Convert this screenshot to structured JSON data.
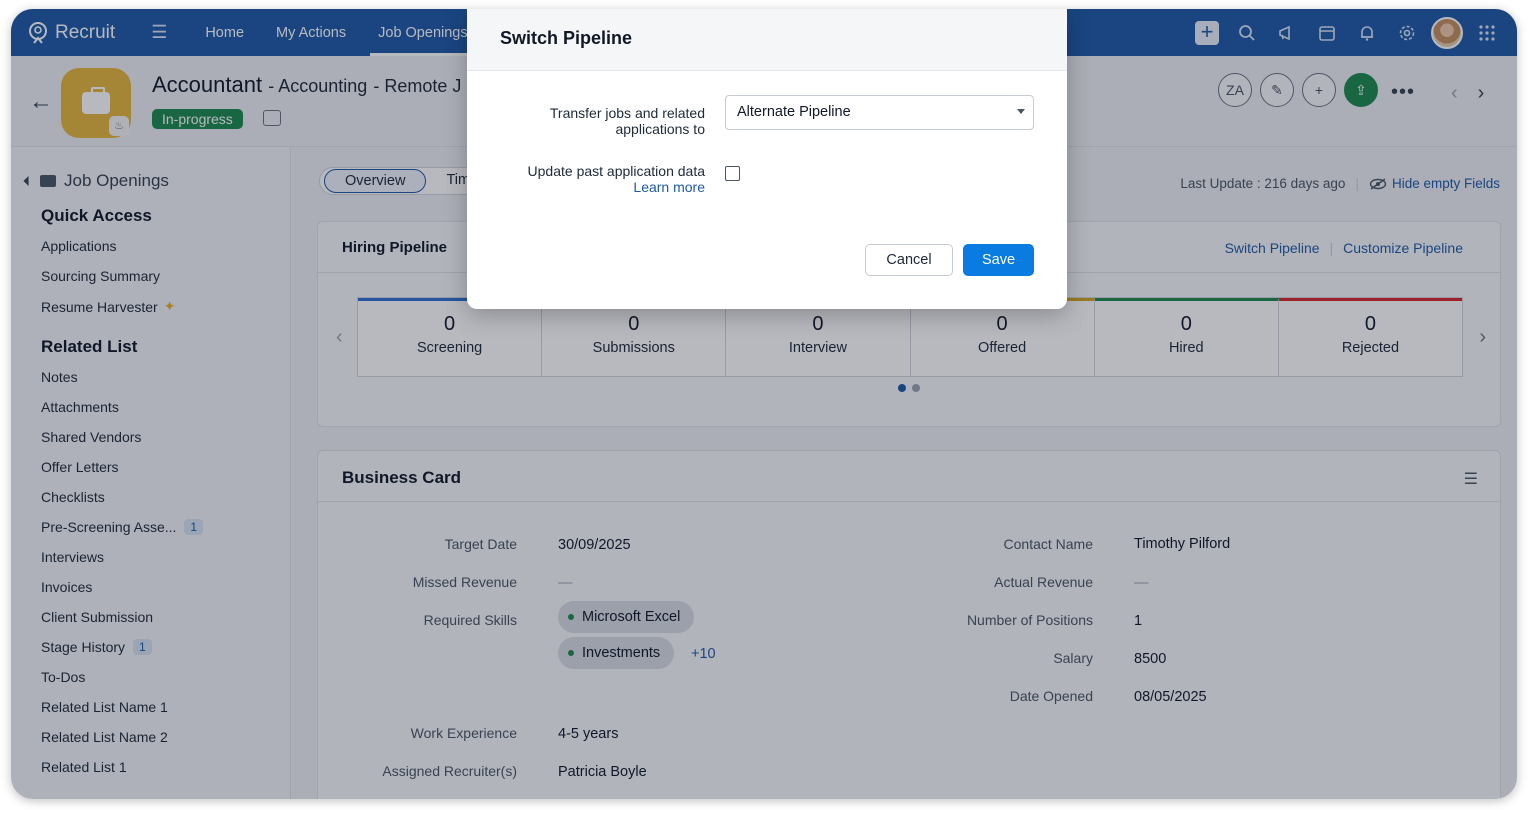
{
  "app": {
    "name": "Recruit"
  },
  "nav": {
    "links": [
      "Home",
      "My Actions",
      "Job Openings"
    ],
    "active_index": 2
  },
  "header": {
    "title": "Accountant",
    "department": "Accounting",
    "location_partial": "Remote J",
    "status": "In-progress"
  },
  "sidebar": {
    "module": "Job Openings",
    "quick_access_title": "Quick Access",
    "quick_access": [
      {
        "label": "Applications"
      },
      {
        "label": "Sourcing Summary"
      },
      {
        "label": "Resume Harvester"
      }
    ],
    "related_list_title": "Related List",
    "related_list": [
      {
        "label": "Notes",
        "count": ""
      },
      {
        "label": "Attachments",
        "count": ""
      },
      {
        "label": "Shared Vendors",
        "count": ""
      },
      {
        "label": "Offer Letters",
        "count": ""
      },
      {
        "label": "Checklists",
        "count": ""
      },
      {
        "label": "Pre-Screening Asse...",
        "count": "1"
      },
      {
        "label": "Interviews",
        "count": ""
      },
      {
        "label": "Invoices",
        "count": ""
      },
      {
        "label": "Client Submission",
        "count": ""
      },
      {
        "label": "Stage History",
        "count": "1"
      },
      {
        "label": "To-Dos",
        "count": ""
      },
      {
        "label": "Related List Name 1",
        "count": ""
      },
      {
        "label": "Related List Name 2",
        "count": ""
      },
      {
        "label": "Related List 1",
        "count": ""
      }
    ]
  },
  "main": {
    "tabs": [
      "Overview",
      "Tim"
    ],
    "last_update": "Last Update : 216 days ago",
    "hide_empty": "Hide empty Fields"
  },
  "pipeline": {
    "title": "Hiring Pipeline",
    "switch_link": "Switch Pipeline",
    "customize_link": "Customize Pipeline",
    "stages": [
      {
        "label": "Screening",
        "count": "0",
        "color": "#2f6fd6"
      },
      {
        "label": "Submissions",
        "count": "0",
        "color": "#2f6fd6"
      },
      {
        "label": "Interview",
        "count": "0",
        "color": "#e0a21a"
      },
      {
        "label": "Offered",
        "count": "0",
        "color": "#d6a51e"
      },
      {
        "label": "Hired",
        "count": "0",
        "color": "#1e8a4c"
      },
      {
        "label": "Rejected",
        "count": "0",
        "color": "#d62828"
      }
    ],
    "page": 1,
    "pages": 2
  },
  "business_card": {
    "title": "Business Card",
    "left": [
      {
        "label": "Target Date",
        "value": "30/09/2025"
      },
      {
        "label": "Missed Revenue",
        "value": "—"
      },
      {
        "label": "Required Skills",
        "value": ""
      },
      {
        "label": "Work Experience",
        "value": "4-5 years"
      },
      {
        "label": "Assigned Recruiter(s)",
        "value": "Patricia Boyle"
      }
    ],
    "skills": [
      "Microsoft Excel",
      "Investments"
    ],
    "skills_more": "+10",
    "right": [
      {
        "label": "Contact Name",
        "value": "Timothy Pilford"
      },
      {
        "label": "Actual Revenue",
        "value": "—"
      },
      {
        "label": "Number of Positions",
        "value": "1"
      },
      {
        "label": "Salary",
        "value": "8500"
      },
      {
        "label": "Date Opened",
        "value": "08/05/2025"
      }
    ]
  },
  "modal": {
    "title": "Switch Pipeline",
    "transfer_label_1": "Transfer jobs and related",
    "transfer_label_2": "applications to",
    "selected_pipeline": "Alternate Pipeline",
    "update_label": "Update past application data",
    "learn_more": "Learn more",
    "update_checked": false,
    "cancel": "Cancel",
    "save": "Save"
  }
}
